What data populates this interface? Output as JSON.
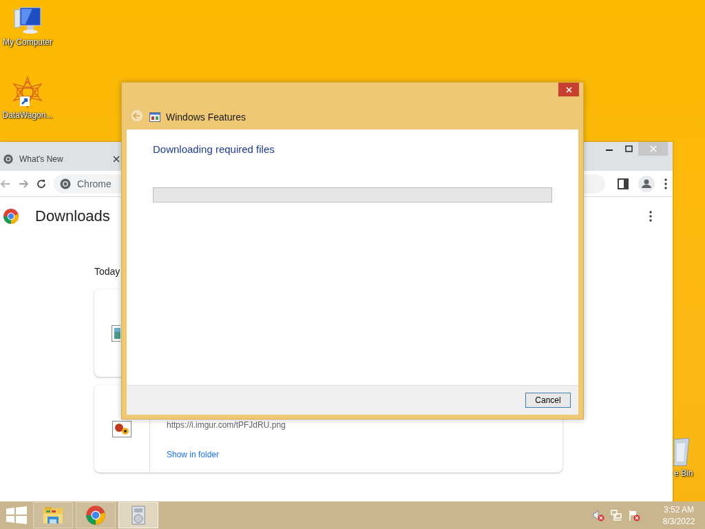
{
  "desktop_icons": [
    {
      "kind": "computer",
      "label": "My Computer"
    },
    {
      "kind": "shortcut",
      "label": "DataWagon..."
    },
    {
      "kind": "recycle",
      "label": "e Bin"
    }
  ],
  "browser": {
    "tabs": [
      {
        "label": "What's New",
        "selected": true
      }
    ],
    "address": "Chrome",
    "page_title": "Downloads",
    "section": "Today",
    "downloads": [
      {
        "kind": "image"
      },
      {
        "kind": "image",
        "url": "https://i.imgur.com/tPFJdRU.png",
        "action": "Show in folder"
      }
    ]
  },
  "dialog": {
    "title": "Windows Features",
    "heading": "Downloading required files",
    "progress": {
      "level": 0
    },
    "buttons": [
      "Cancel"
    ]
  },
  "taskbar": {
    "apps": [
      {
        "kind": "explorer",
        "selected": false
      },
      {
        "kind": "chrome",
        "selected": false
      },
      {
        "kind": "features",
        "selected": true
      }
    ],
    "time": "3:52 AM",
    "date": "8/3/2022"
  }
}
